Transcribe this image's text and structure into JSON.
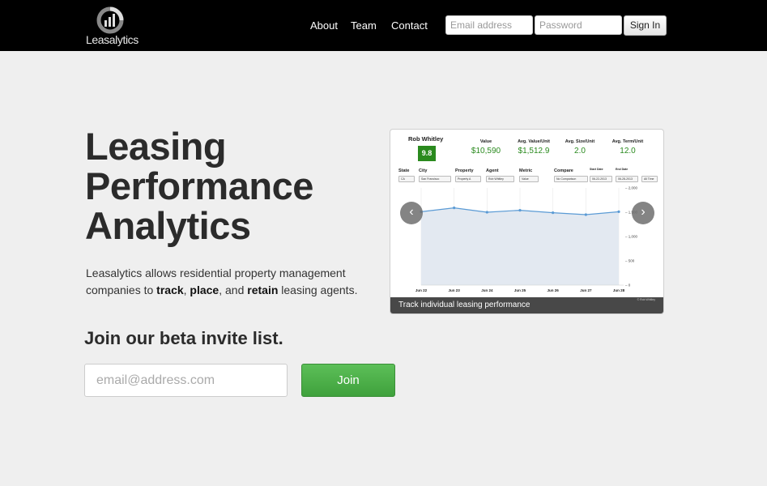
{
  "nav": {
    "brand": "Leasalytics",
    "links": [
      "About",
      "Team",
      "Contact"
    ],
    "email_placeholder": "Email address",
    "password_placeholder": "Password",
    "signin_label": "Sign In"
  },
  "hero": {
    "title_lines": [
      "Leasing",
      "Performance",
      "Analytics"
    ],
    "desc_pre": "Leasalytics allows residential property management companies to ",
    "track": "track",
    "comma1": ", ",
    "place": "place",
    "and_txt": ", and ",
    "retain": "retain",
    "desc_post": " leasing agents."
  },
  "beta": {
    "title": "Join our beta invite list.",
    "email_placeholder": "email@address.com",
    "join_label": "Join"
  },
  "card": {
    "agent_name": "Rob Whitley",
    "score": "9.8",
    "stats": [
      {
        "label": "Value",
        "value": "$10,590"
      },
      {
        "label": "Avg. Value/Unit",
        "value": "$1,512.9"
      },
      {
        "label": "Avg. Size/Unit",
        "value": "2.0"
      },
      {
        "label": "Avg. Term/Unit",
        "value": "12.0"
      }
    ],
    "filters": [
      {
        "label": "State",
        "value": "CA"
      },
      {
        "label": "City",
        "value": "San Francisco"
      },
      {
        "label": "Property",
        "value": "Property A"
      },
      {
        "label": "Agent",
        "value": "Rob Whitley"
      },
      {
        "label": "Metric",
        "value": "Value"
      },
      {
        "label": "Compare",
        "value": "No Comparison"
      },
      {
        "label": "Start Date",
        "value": "06-22-2013"
      },
      {
        "label": "End Date",
        "value": "06-28-2013"
      }
    ],
    "all_time": "All Time",
    "caption": "Track individual leasing performance",
    "caption_small": "© Rob Whitley",
    "prev_icon": "chevron-left-icon",
    "next_icon": "chevron-right-icon"
  },
  "chart_data": {
    "type": "area",
    "categories": [
      "Jun 22",
      "Jun 23",
      "Jun 24",
      "Jun 25",
      "Jun 26",
      "Jun 27",
      "Jun 28"
    ],
    "values": [
      1510,
      1590,
      1500,
      1540,
      1490,
      1450,
      1510
    ],
    "yticks": [
      "2,000",
      "1,500",
      "1,000",
      "500",
      "0"
    ],
    "ylim": [
      0,
      2000
    ],
    "colors": {
      "line": "#5b9bd5",
      "fill": "#e3e9f1"
    }
  }
}
